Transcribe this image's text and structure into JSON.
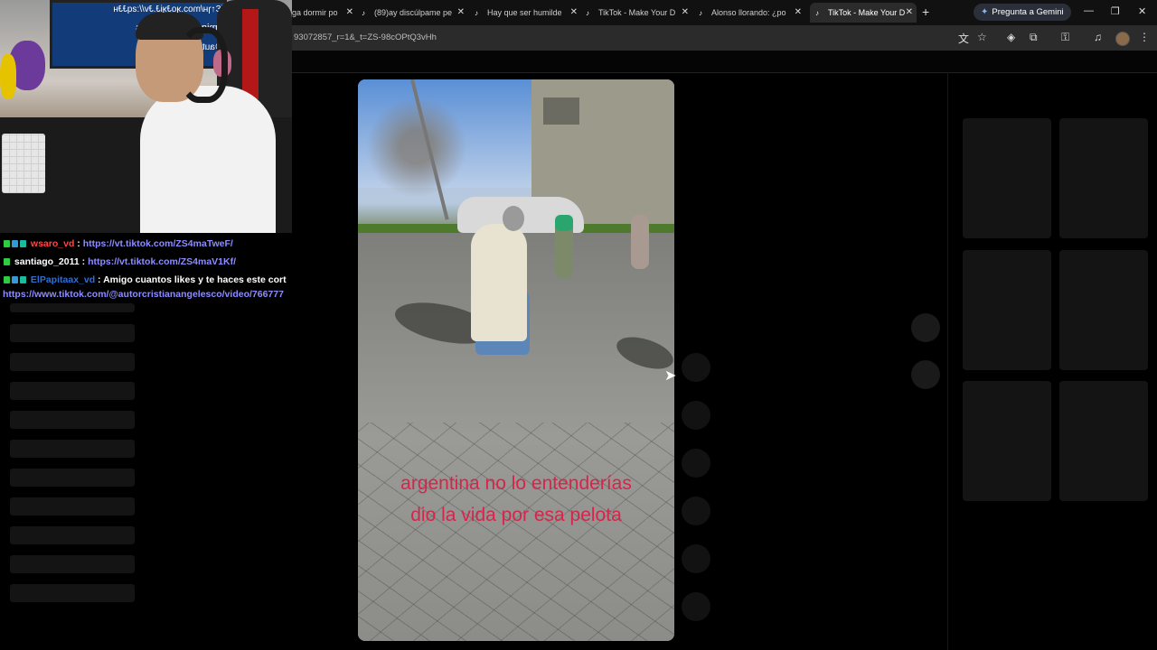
{
  "tabs": [
    {
      "title": "ga dormir po",
      "active": false
    },
    {
      "title": "(89)ay discúlpame pe",
      "active": false
    },
    {
      "title": "Hay que ser humilde",
      "active": false
    },
    {
      "title": "TikTok - Make Your D",
      "active": false
    },
    {
      "title": "Alonso llorando: ¿po",
      "active": false
    },
    {
      "title": "TikTok - Make Your D",
      "active": true
    }
  ],
  "gemini_label": "Pregunta a Gemini",
  "url": "93072857_r=1&_t=ZS-98cOPtQ3vHh",
  "webcam": {
    "monitor_lines": [
      "(Ɛ↑ɿʜ/moɔ.ʞoɈʞiɈ.Ɉv//:ƨqɈɈʜ",
      "Amigo cuantos likes",
      "@autorcristianang"
    ]
  },
  "chat": [
    {
      "user": "wsaro_vd",
      "text": "https://vt.tiktok.com/ZS4maTweF/",
      "user_color": "#ff4545"
    },
    {
      "user": "santiago_2011",
      "text": "https://vt.tiktok.com/ZS4maV1Kf/",
      "user_color": "#ffffff"
    },
    {
      "user": "ElPapitaax_vd",
      "text": "Amigo cuantos likes y te haces este cort",
      "user_color": "#2e6fd6"
    },
    {
      "user": "",
      "text": "https://www.tiktok.com/@autorcristianangelesco/video/766777",
      "user_color": "#8e8cff"
    }
  ],
  "video": {
    "caption_line1": "argentina no lo entenderías",
    "caption_line2": "dio la vida por esa pelota"
  },
  "icons": {
    "translate": "translate-icon",
    "bookmark": "star-icon",
    "extension": "puzzle-icon",
    "password": "key-icon",
    "media": "media-control-icon",
    "menu": "more-vert-icon"
  }
}
